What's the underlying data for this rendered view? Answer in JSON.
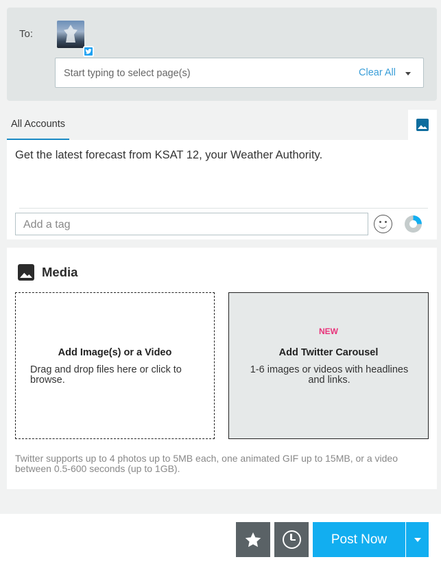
{
  "recipients": {
    "to_label": "To:",
    "selected_page": {
      "network": "twitter",
      "avatar_icon": "page-avatar"
    },
    "search_placeholder": "Start typing to select page(s)",
    "clear_all_label": "Clear All"
  },
  "tabs": {
    "all_accounts_label": "All Accounts",
    "media_tab_icon": "image-icon"
  },
  "compose": {
    "message": "Get the latest forecast from KSAT 12, your Weather Authority.",
    "tag_placeholder": "Add a tag",
    "emoji_icon": "smiley-icon",
    "char_count_progress": 0.25
  },
  "media": {
    "title": "Media",
    "upload": {
      "heading": "Add Image(s) or a Video",
      "subtext": "Drag and drop files here or click to browse."
    },
    "carousel": {
      "badge": "NEW",
      "heading": "Add Twitter Carousel",
      "subtext": "1-6 images or videos with headlines and links."
    },
    "note": "Twitter supports up to 4 photos up to 5MB each, one animated GIF up to 15MB, or a video between 0.5-600 seconds (up to 1GB)."
  },
  "footer": {
    "favorite_icon": "star-icon",
    "schedule_icon": "clock-icon",
    "post_label": "Post Now"
  },
  "colors": {
    "accent": "#12aef0",
    "link": "#3a9ed8",
    "new_badge": "#e8337a",
    "twitter": "#1da1f2"
  }
}
